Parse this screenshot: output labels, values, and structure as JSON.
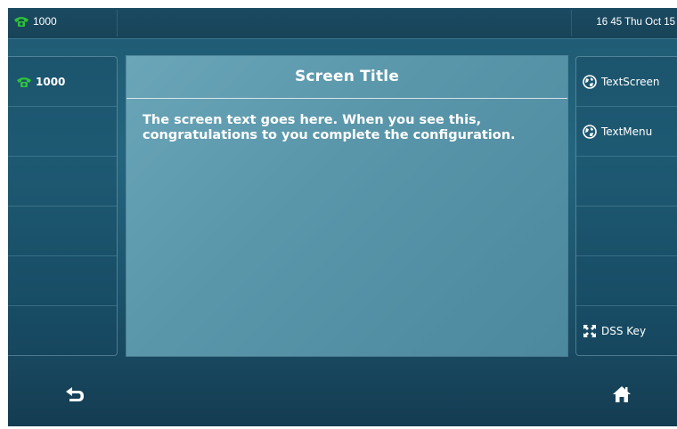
{
  "status_bar": {
    "line_icon": "phone-icon",
    "line_label": "1000",
    "clock": "16 45 Thu Oct 15"
  },
  "left_column": {
    "items": [
      {
        "icon": "phone-icon",
        "label": "1000"
      },
      {
        "label": ""
      },
      {
        "label": ""
      },
      {
        "label": ""
      },
      {
        "label": ""
      },
      {
        "label": ""
      }
    ]
  },
  "panel": {
    "title": "Screen Title",
    "text": "The screen text goes here. When you see this, congratulations to you complete the configuration."
  },
  "right_column": {
    "items": [
      {
        "icon": "globe-icon",
        "label": "TextScreen"
      },
      {
        "icon": "globe-icon",
        "label": "TextMenu"
      },
      {
        "label": ""
      },
      {
        "label": ""
      },
      {
        "label": ""
      },
      {
        "icon": "expand-icon",
        "label": "DSS Key"
      }
    ]
  },
  "bottom_bar": {
    "back_icon": "back-arrow-icon",
    "home_icon": "home-icon"
  },
  "colors": {
    "phone_green": "#2ec23a",
    "background": "#1f5a72",
    "panel": "#5b97ab"
  }
}
